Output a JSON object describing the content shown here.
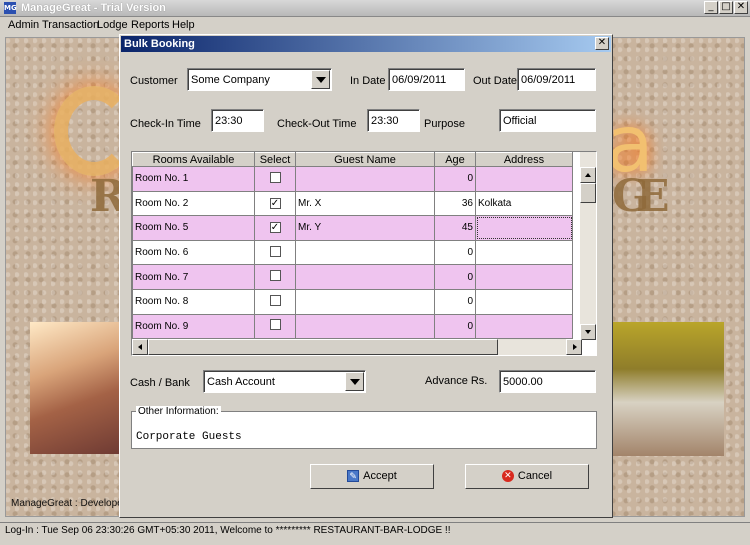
{
  "app": {
    "icon_text": "MG",
    "title": "ManageGreat - Trial Version",
    "window_buttons": {
      "minimize": "_",
      "maximize": "□",
      "close": "✕"
    }
  },
  "menu": [
    "Admin",
    "Transaction",
    "Lodge",
    "Reports",
    "Help"
  ],
  "background": {
    "letter_r": "R",
    "letter_g": "G",
    "letter_e": "E",
    "letter_a": "a",
    "developer_text": "ManageGreat : Developed b"
  },
  "dialog": {
    "title": "Bulk Booking",
    "close_glyph": "✕",
    "customer_label": "Customer",
    "customer_value": "Some Company",
    "in_date_label": "In Date :",
    "in_date_value": "06/09/2011",
    "out_date_label": "Out Date :",
    "out_date_value": "06/09/2011",
    "checkin_label": "Check-In Time",
    "checkin_value": "23:30",
    "checkout_label": "Check-Out Time",
    "checkout_value": "23:30",
    "purpose_label": "Purpose",
    "purpose_value": "Official",
    "table": {
      "columns": [
        "Rooms Available",
        "Select",
        "Guest Name",
        "Age",
        "Address"
      ],
      "rows": [
        {
          "room": "Room No. 1",
          "checked": "",
          "guest": "",
          "age": "0",
          "address": ""
        },
        {
          "room": "Room No. 2",
          "checked": "✓",
          "guest": "Mr. X",
          "age": "36",
          "address": "Kolkata"
        },
        {
          "room": "Room No. 5",
          "checked": "✓",
          "guest": "Mr. Y",
          "age": "45",
          "address": ""
        },
        {
          "room": "Room No. 6",
          "checked": "",
          "guest": "",
          "age": "0",
          "address": ""
        },
        {
          "room": "Room No. 7",
          "checked": "",
          "guest": "",
          "age": "0",
          "address": ""
        },
        {
          "room": "Room No. 8",
          "checked": "",
          "guest": "",
          "age": "0",
          "address": ""
        },
        {
          "room": "Room No. 9",
          "checked": "",
          "guest": "",
          "age": "0",
          "address": ""
        }
      ],
      "row_colors": {
        "odd": "#efc4ef",
        "even": "#ffffff"
      }
    },
    "cash_bank_label": "Cash / Bank",
    "cash_bank_value": "Cash Account",
    "advance_label": "Advance Rs.",
    "advance_value": "5000.00",
    "other_info_title": "Other Information:",
    "other_info_text": "Corporate Guests",
    "accept_label": "Accept",
    "cancel_label": "Cancel",
    "accept_icon_glyph": "✎",
    "cancel_icon_glyph": "✕"
  },
  "status": "Log-In : Tue Sep 06 23:30:26 GMT+05:30 2011, Welcome to ********* RESTAURANT-BAR-LODGE !!"
}
